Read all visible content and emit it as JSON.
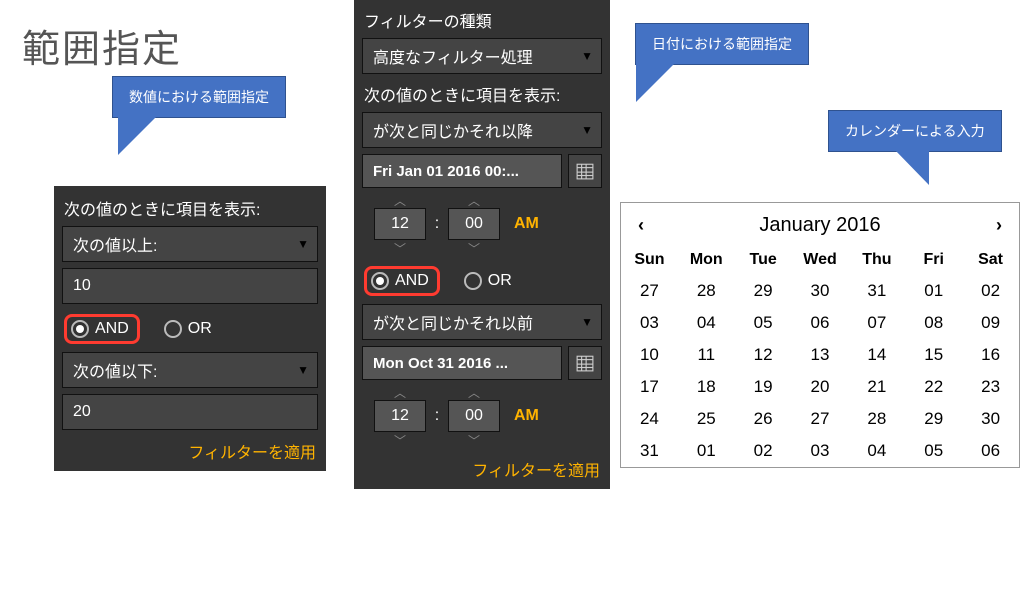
{
  "title": "範囲指定",
  "callouts": {
    "numeric": "数値における範囲指定",
    "date": "日付における範囲指定",
    "calendar": "カレンダーによる入力"
  },
  "numPanel": {
    "showWhen": "次の値のときに項目を表示:",
    "op1": "次の値以上:",
    "val1": "10",
    "and": "AND",
    "or": "OR",
    "op2": "次の値以下:",
    "val2": "20",
    "apply": "フィルターを適用"
  },
  "datePanel": {
    "filterTypeLabel": "フィルターの種類",
    "filterTypeValue": "高度なフィルター処理",
    "showWhen": "次の値のときに項目を表示:",
    "op1": "が次と同じかそれ以降",
    "date1": "Fri Jan 01 2016 00:...",
    "hour1": "12",
    "min1": "00",
    "ampm1": "AM",
    "and": "AND",
    "or": "OR",
    "op2": "が次と同じかそれ以前",
    "date2": "Mon Oct 31 2016 ...",
    "hour2": "12",
    "min2": "00",
    "ampm2": "AM",
    "apply": "フィルターを適用"
  },
  "calendar": {
    "title": "January 2016",
    "dow": [
      "Sun",
      "Mon",
      "Tue",
      "Wed",
      "Thu",
      "Fri",
      "Sat"
    ],
    "days": [
      "27",
      "28",
      "29",
      "30",
      "31",
      "01",
      "02",
      "03",
      "04",
      "05",
      "06",
      "07",
      "08",
      "09",
      "10",
      "11",
      "12",
      "13",
      "14",
      "15",
      "16",
      "17",
      "18",
      "19",
      "20",
      "21",
      "22",
      "23",
      "24",
      "25",
      "26",
      "27",
      "28",
      "29",
      "30",
      "31",
      "01",
      "02",
      "03",
      "04",
      "05",
      "06"
    ]
  }
}
